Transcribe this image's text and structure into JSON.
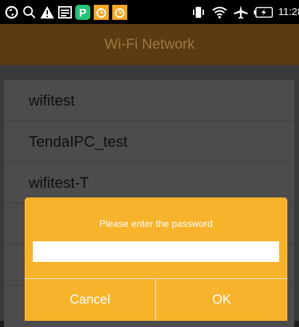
{
  "status_bar": {
    "icons": [
      "sync-icon",
      "search-icon",
      "warning-icon",
      "image-icon",
      "parking-app-icon",
      "alarm-clock-icon",
      "alarm-clock-icon",
      "vibrate-icon",
      "wifi-icon",
      "airplane-icon",
      "battery-charging-icon"
    ],
    "time": "11:28"
  },
  "title": "Wi-Fi Network",
  "networks": [
    "wifitest",
    "TendaIPC_test",
    "wifitest-T"
  ],
  "dialog": {
    "prompt": "Please enter the password",
    "password_value": "",
    "cancel_label": "Cancel",
    "ok_label": "OK"
  },
  "colors": {
    "title_bar": "#5c3a12",
    "dialog_bg": "#f7b32b",
    "overlay_list": "#4c4c4c"
  }
}
